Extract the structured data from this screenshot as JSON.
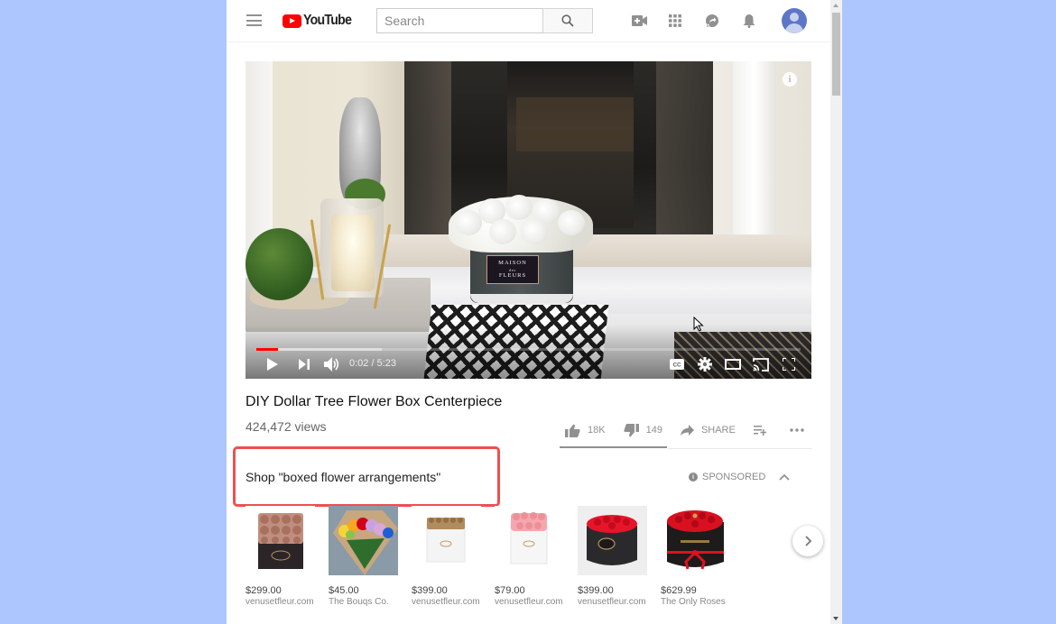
{
  "masthead": {
    "logo_text": "YouTube",
    "search_placeholder": "Search",
    "icons": [
      "menu-icon",
      "create-video-icon",
      "apps-icon",
      "messages-icon",
      "notifications-icon",
      "account-avatar"
    ]
  },
  "player": {
    "overlay_text": [
      "MAISON",
      "des",
      "FLEURS"
    ],
    "current_time": "0:02",
    "duration": "5:23",
    "time_display": "0:02 / 5:23",
    "progress_played_fraction": 0.006,
    "progress_loaded_fraction": 0.23,
    "controls": [
      "play",
      "next",
      "volume",
      "captions",
      "settings",
      "theater-mode",
      "cast",
      "fullscreen"
    ]
  },
  "video": {
    "title": "DIY Dollar Tree Flower Box Centerpiece",
    "views": "424,472 views",
    "likes": "18K",
    "dislikes": "149",
    "share_label": "SHARE",
    "like_fraction": 0.99
  },
  "shopping": {
    "title": "Shop \"boxed flower arrangements\"",
    "sponsored_label": "SPONSORED",
    "products": [
      {
        "price": "$299.00",
        "seller": "venusetfleur.com",
        "image": "rose-gold roses in black square box"
      },
      {
        "price": "$45.00",
        "seller": "The Bouqs Co.",
        "image": "rainbow rose bouquet"
      },
      {
        "price": "$399.00",
        "seller": "venusetfleur.com",
        "image": "gold roses in white box"
      },
      {
        "price": "$79.00",
        "seller": "venusetfleur.com",
        "image": "pink roses in white box"
      },
      {
        "price": "$399.00",
        "seller": "venusetfleur.com",
        "image": "red roses in black round box"
      },
      {
        "price": "$629.99",
        "seller": "The Only Roses",
        "image": "red roses in black round box with bow"
      }
    ]
  },
  "colors": {
    "background": "#adc6fe",
    "brand_red": "#ff0000",
    "highlight_border": "#ef4f4f",
    "icon_gray": "#909090",
    "avatar_blue": "#5e76c6"
  }
}
